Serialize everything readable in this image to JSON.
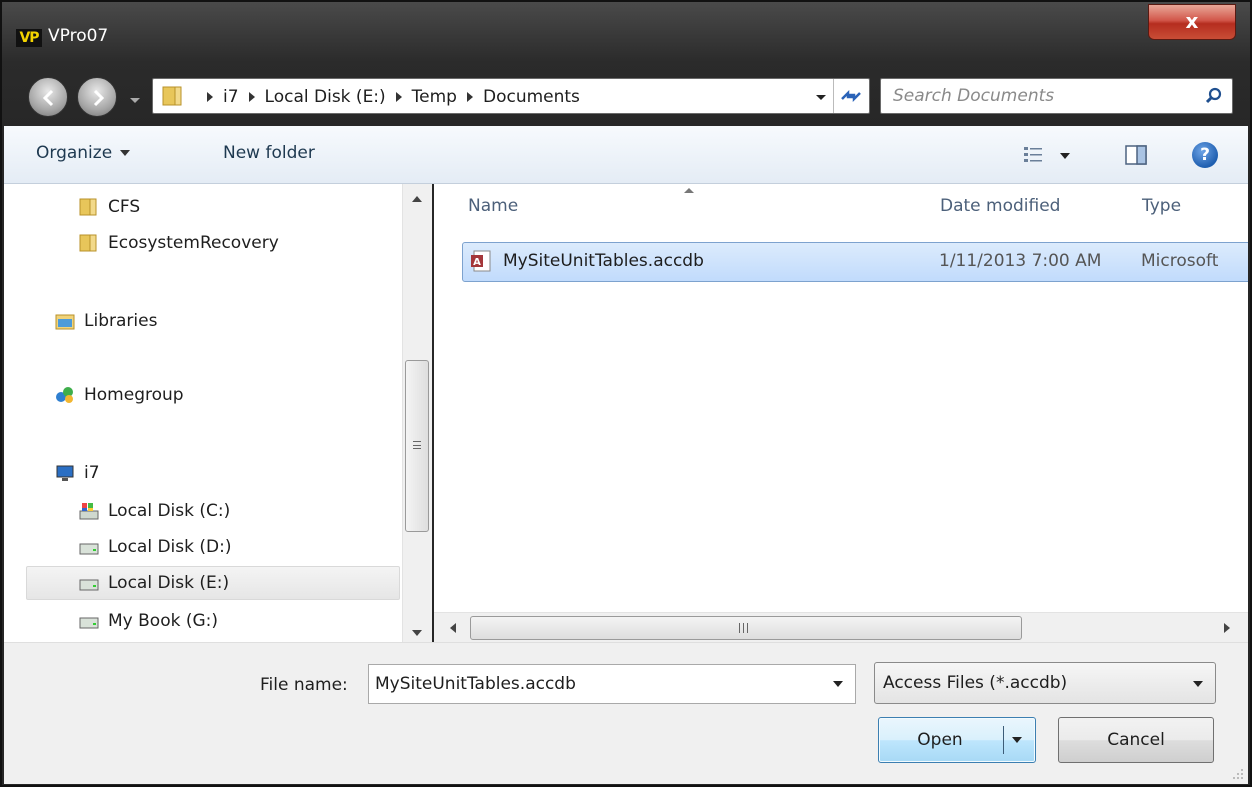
{
  "window": {
    "app_badge": "VP",
    "title": "VPro07",
    "close_glyph": "x"
  },
  "address_bar": {
    "crumbs": [
      "i7",
      "Local Disk (E:)",
      "Temp",
      "Documents"
    ]
  },
  "search": {
    "placeholder": "Search Documents"
  },
  "toolbar": {
    "organize_label": "Organize",
    "new_folder_label": "New folder",
    "help_glyph": "?"
  },
  "nav_pane": {
    "items": [
      {
        "label": "CFS",
        "icon": "folder-icon"
      },
      {
        "label": "EcosystemRecovery",
        "icon": "folder-icon"
      },
      {
        "label": "Libraries",
        "icon": "libraries-icon"
      },
      {
        "label": "Homegroup",
        "icon": "homegroup-icon"
      },
      {
        "label": "i7",
        "icon": "computer-icon"
      },
      {
        "label": "Local Disk (C:)",
        "icon": "system-drive-icon"
      },
      {
        "label": "Local Disk (D:)",
        "icon": "drive-icon"
      },
      {
        "label": "Local Disk (E:)",
        "icon": "drive-icon",
        "selected": true
      },
      {
        "label": "My Book (G:)",
        "icon": "drive-icon"
      }
    ]
  },
  "file_list": {
    "columns": [
      "Name",
      "Date modified",
      "Type"
    ],
    "rows": [
      {
        "name": "MySiteUnitTables.accdb",
        "date_modified": "1/11/2013 7:00 AM",
        "type": "Microsoft",
        "icon": "access-file-icon"
      }
    ]
  },
  "bottom": {
    "file_name_label": "File name:",
    "file_name_value": "MySiteUnitTables.accdb",
    "file_type_value": "Access Files (*.accdb)",
    "open_label": "Open",
    "cancel_label": "Cancel"
  },
  "colors": {
    "selection_fill": "#c8e0fb",
    "selection_border": "#7da2ce",
    "toolbar_text": "#1e3950"
  }
}
